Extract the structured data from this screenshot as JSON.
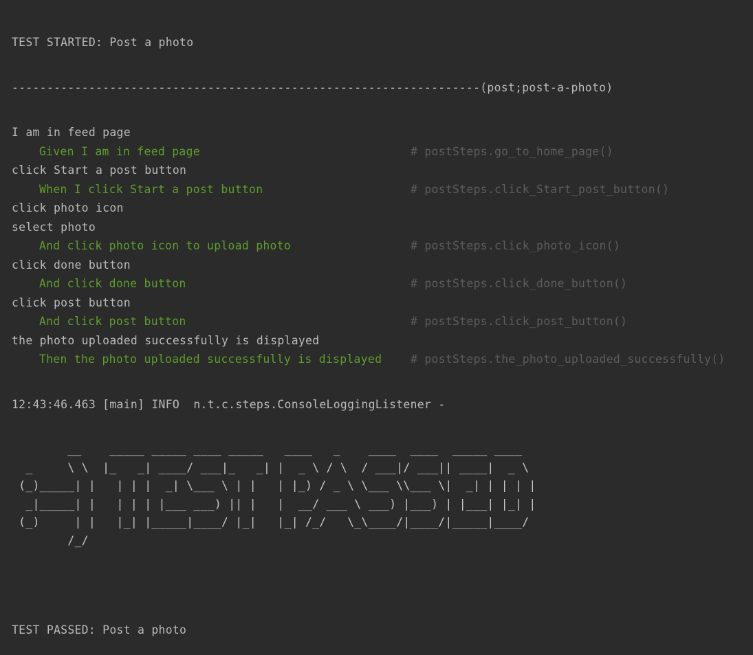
{
  "console": {
    "header": "TEST STARTED: Post a photo",
    "separator": "-------------------------------------------------------------------(post;post-a-photo)",
    "entries": [
      {
        "type": "log",
        "text": "I am in feed page"
      },
      {
        "type": "step",
        "text": "Given I am in feed page",
        "ref": "# postSteps.go_to_home_page()"
      },
      {
        "type": "log",
        "text": "click Start a post button"
      },
      {
        "type": "step",
        "text": "When I click Start a post button",
        "ref": "# postSteps.click_Start_post_button()"
      },
      {
        "type": "log",
        "text": "click photo icon"
      },
      {
        "type": "log",
        "text": "select photo"
      },
      {
        "type": "step",
        "text": "And click photo icon to upload photo",
        "ref": "# postSteps.click_photo_icon()"
      },
      {
        "type": "log",
        "text": "click done button"
      },
      {
        "type": "step",
        "text": "And click done button",
        "ref": "# postSteps.click_done_button()"
      },
      {
        "type": "log",
        "text": "click post button"
      },
      {
        "type": "step",
        "text": "And click post button",
        "ref": "# postSteps.click_post_button()"
      },
      {
        "type": "log",
        "text": "the photo uploaded successfully is displayed"
      },
      {
        "type": "step",
        "text": "Then the photo uploaded successfully is displayed ",
        "ref": "# postSteps.the_photo_uploaded_successfully()"
      }
    ],
    "info_line": "12:43:46.463 [main] INFO  n.t.c.steps.ConsoleLoggingListener -",
    "banner": [
      "        __    _____ _____ ____ _____   ____   _    ____  ____  _____ ____",
      "  _     \\ \\  |_   _| ____/ ___|_   _| |  _ \\ / \\  / ___|/ ___|| ____|  _ \\",
      " (_)_____| |   | | |  _| \\___ \\ | |   | |_) / _ \\ \\___ \\\\___ \\|  _| | | | |",
      "  _|_____| |   | | | |___ ___) || |   |  __/ ___ \\ ___) |___) | |___| |_| |",
      " (_)     | |   |_| |_____|____/ |_|   |_| /_/   \\_\\____/|____/|_____|____/",
      "        /_/"
    ],
    "footer": "TEST PASSED: Post a photo"
  },
  "colors": {
    "background": "#2b2b2b",
    "text": "#bbbbbb",
    "step": "#5e9e2b",
    "reference": "#5d5d5d"
  }
}
